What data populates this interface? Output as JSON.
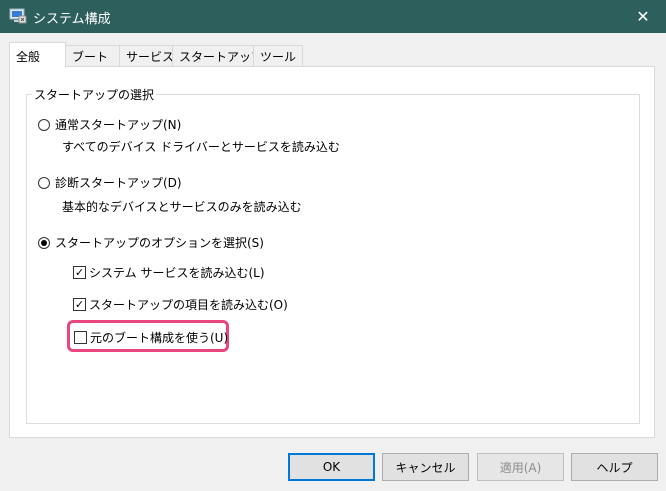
{
  "window": {
    "title": "システム構成",
    "icon": "msconfig-icon",
    "close_glyph": "✕"
  },
  "tabs": [
    {
      "label": "全般",
      "active": true
    },
    {
      "label": "ブート",
      "active": false
    },
    {
      "label": "サービス",
      "active": false
    },
    {
      "label": "スタートアップ",
      "active": false
    },
    {
      "label": "ツール",
      "active": false
    }
  ],
  "startup_selection": {
    "group_label": "スタートアップの選択",
    "normal": {
      "label": "通常スタートアップ(N)",
      "description": "すべてのデバイス ドライバーとサービスを読み込む",
      "selected": false
    },
    "diagnostic": {
      "label": "診断スタートアップ(D)",
      "description": "基本的なデバイスとサービスのみを読み込む",
      "selected": false
    },
    "selective": {
      "label": "スタートアップのオプションを選択(S)",
      "selected": true,
      "options": [
        {
          "label": "システム サービスを読み込む(L)",
          "checked": true
        },
        {
          "label": "スタートアップの項目を読み込む(O)",
          "checked": true
        },
        {
          "label": "元のブート構成を使う(U)",
          "checked": false
        }
      ]
    }
  },
  "highlight_color": "#e8467c",
  "buttons": {
    "ok": "OK",
    "cancel": "キャンセル",
    "apply": "適用(A)",
    "help": "ヘルプ"
  }
}
